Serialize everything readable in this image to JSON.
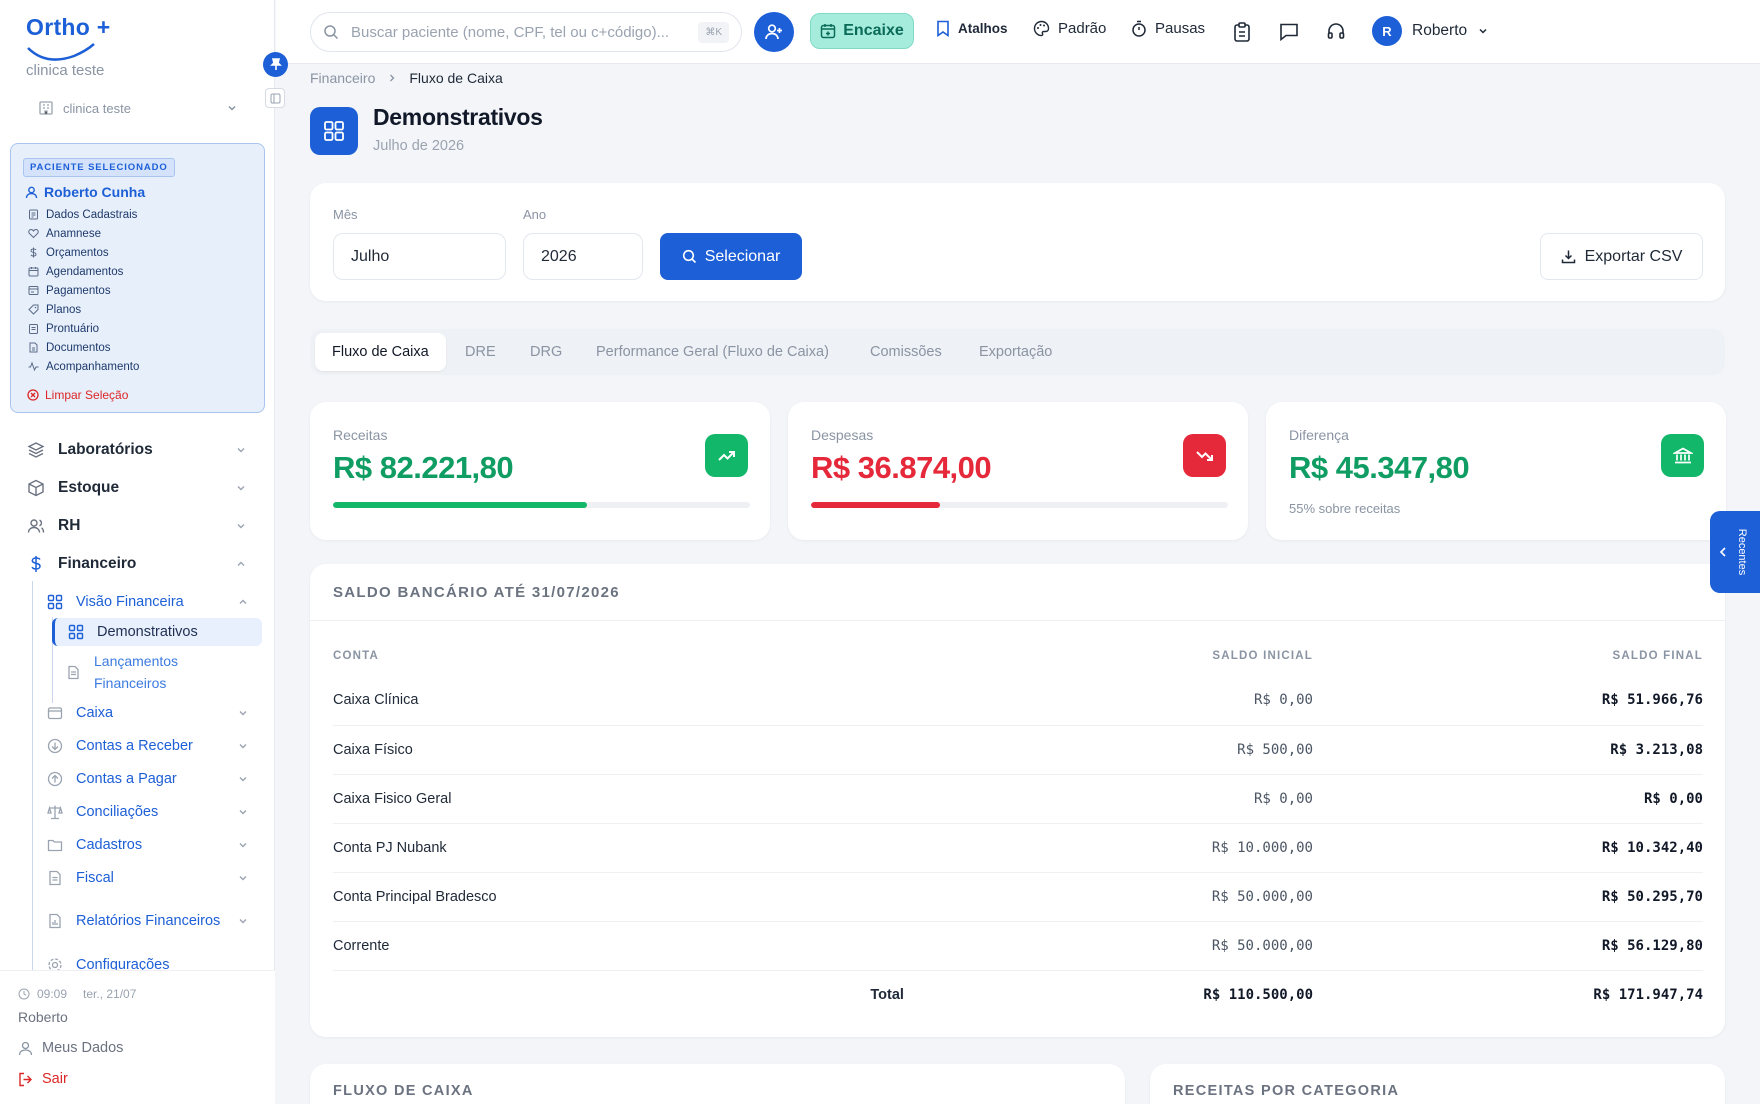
{
  "sidebar": {
    "logo": "Ortho +",
    "clinic_name": "clinica teste",
    "clinic_select": "clinica teste",
    "patient": {
      "badge": "PACIENTE SELECIONADO",
      "name": "Roberto Cunha",
      "menu": [
        "Dados Cadastrais",
        "Anamnese",
        "Orçamentos",
        "Agendamentos",
        "Pagamentos",
        "Planos",
        "Prontuário",
        "Documentos",
        "Acompanhamento"
      ],
      "clear": "Limpar Seleção"
    },
    "nav": {
      "laboratorios": "Laboratórios",
      "estoque": "Estoque",
      "rh": "RH",
      "financeiro": "Financeiro",
      "visao_financeira": "Visão Financeira",
      "demonstrativos": "Demonstrativos",
      "lancamentos": "Lançamentos Financeiros",
      "caixa": "Caixa",
      "contas_receber": "Contas a Receber",
      "contas_pagar": "Contas a Pagar",
      "conciliacoes": "Conciliações",
      "cadastros": "Cadastros",
      "fiscal": "Fiscal",
      "relatorios": "Relatórios Financeiros",
      "configuracoes": "Configurações"
    },
    "footer": {
      "time": "09:09",
      "date": "ter., 21/07",
      "user": "Roberto",
      "meus_dados": "Meus Dados",
      "sair": "Sair"
    }
  },
  "topbar": {
    "search_placeholder": "Buscar paciente (nome, CPF, tel ou c+código)...",
    "search_kbd": "⌘K",
    "encaixe": "Encaixe",
    "atalhos": "Atalhos",
    "padrao": "Padrão",
    "pausas": "Pausas",
    "user_initial": "R",
    "user_name": "Roberto"
  },
  "breadcrumb": {
    "parent": "Financeiro",
    "current": "Fluxo de Caixa"
  },
  "page": {
    "title": "Demonstrativos",
    "subtitle": "Julho de 2026"
  },
  "filters": {
    "month_label": "Mês",
    "month_value": "Julho",
    "year_label": "Ano",
    "year_value": "2026",
    "select_button": "Selecionar",
    "export_button": "Exportar CSV"
  },
  "tabs": [
    "Fluxo de Caixa",
    "DRE",
    "DRG",
    "Performance Geral (Fluxo de Caixa)",
    "Comissões",
    "Exportação"
  ],
  "kpis": {
    "receitas": {
      "label": "Receitas",
      "value": "R$ 82.221,80",
      "progress": 0.61,
      "color": "#0f9d63"
    },
    "despesas": {
      "label": "Despesas",
      "value": "R$ 36.874,00",
      "progress": 0.31,
      "color": "#e5283a"
    },
    "diferenca": {
      "label": "Diferença",
      "value": "R$ 45.347,80",
      "note": "55% sobre receitas",
      "color": "#0f9d63"
    }
  },
  "balance": {
    "title": "SALDO BANCÁRIO ATÉ 31/07/2026",
    "headers": {
      "conta": "CONTA",
      "inicial": "SALDO INICIAL",
      "final": "SALDO FINAL"
    },
    "rows": [
      {
        "conta": "Caixa Clínica",
        "inicial": "R$ 0,00",
        "final": "R$ 51.966,76"
      },
      {
        "conta": "Caixa Físico",
        "inicial": "R$ 500,00",
        "final": "R$ 3.213,08"
      },
      {
        "conta": "Caixa Fisico Geral",
        "inicial": "R$ 0,00",
        "final": "R$ 0,00"
      },
      {
        "conta": "Conta PJ Nubank",
        "inicial": "R$ 10.000,00",
        "final": "R$ 10.342,40"
      },
      {
        "conta": "Conta Principal Bradesco",
        "inicial": "R$ 50.000,00",
        "final": "R$ 50.295,70"
      },
      {
        "conta": "Corrente",
        "inicial": "R$ 50.000,00",
        "final": "R$ 56.129,80"
      }
    ],
    "total": {
      "label": "Total",
      "inicial": "R$ 110.500,00",
      "final": "R$ 171.947,74"
    }
  },
  "sections": {
    "fluxo": "FLUXO DE CAIXA",
    "receitas_cat": "RECEITAS POR CATEGORIA"
  },
  "recentes": "Recentes"
}
